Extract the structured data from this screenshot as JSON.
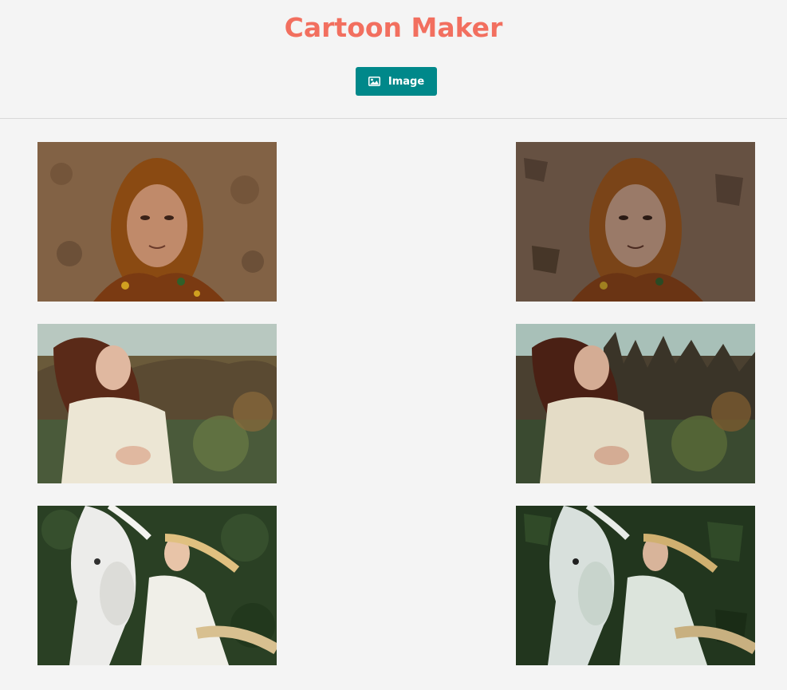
{
  "app": {
    "title": "Cartoon Maker"
  },
  "toolbar": {
    "upload_label": "Image",
    "upload_icon": "image-icon",
    "accent_color": "#00888a",
    "title_color": "#f26f5f"
  },
  "gallery": {
    "rows": [
      {
        "original": "woman-headscarf-photo",
        "cartoon": "woman-headscarf-cartoon"
      },
      {
        "original": "woman-shawl-photo",
        "cartoon": "woman-shawl-cartoon"
      },
      {
        "original": "woman-white-horse-photo",
        "cartoon": "woman-white-horse-cartoon"
      }
    ]
  }
}
